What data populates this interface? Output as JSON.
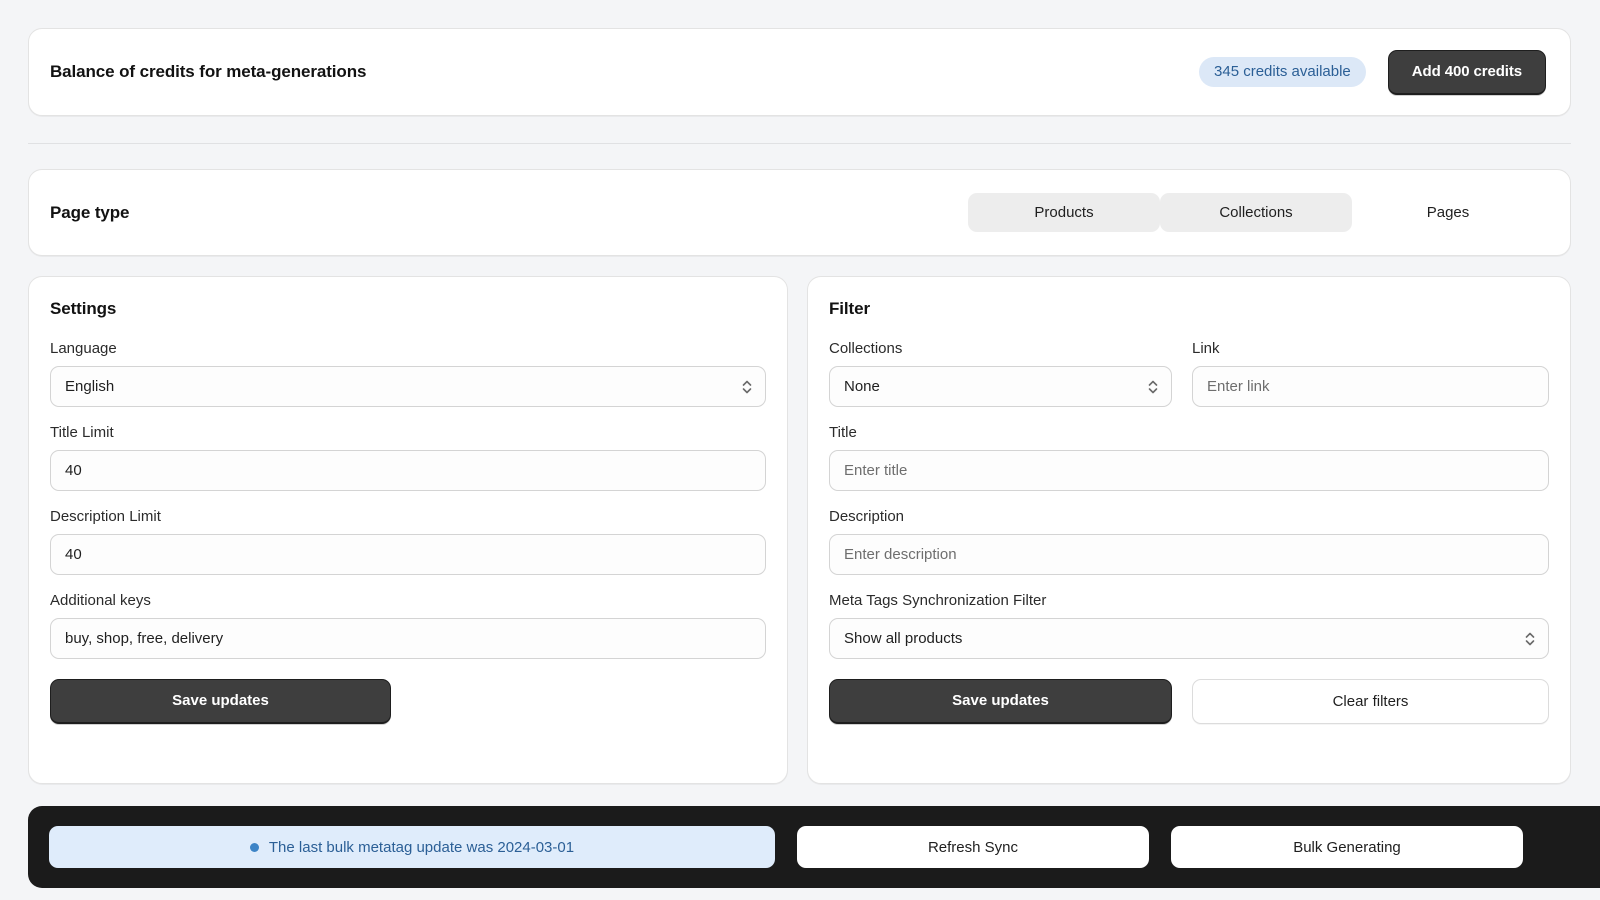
{
  "credits": {
    "title": "Balance of credits for meta-generations",
    "badge": "345 credits available",
    "add_button": "Add 400 credits"
  },
  "page_type": {
    "title": "Page type",
    "tabs": [
      {
        "label": "Products",
        "active": true
      },
      {
        "label": "Collections",
        "active": true
      },
      {
        "label": "Pages",
        "active": false
      }
    ]
  },
  "settings": {
    "title": "Settings",
    "language_label": "Language",
    "language_value": "English",
    "title_limit_label": "Title Limit",
    "title_limit_value": "40",
    "description_limit_label": "Description Limit",
    "description_limit_value": "40",
    "additional_keys_label": "Additional keys",
    "additional_keys_value": "buy, shop, free, delivery",
    "save_button": "Save updates"
  },
  "filter": {
    "title": "Filter",
    "collections_label": "Collections",
    "collections_value": "None",
    "link_label": "Link",
    "link_placeholder": "Enter link",
    "link_value": "",
    "title_label": "Title",
    "title_placeholder": "Enter title",
    "title_value": "",
    "description_label": "Description",
    "description_placeholder": "Enter description",
    "description_value": "",
    "sync_filter_label": "Meta Tags Synchronization Filter",
    "sync_filter_value": "Show all products",
    "save_button": "Save updates",
    "clear_button": "Clear filters"
  },
  "bottom_bar": {
    "status_text": "The last bulk metatag update was 2024-03-01",
    "refresh_button": "Refresh Sync",
    "bulk_button": "Bulk Generating"
  },
  "colors": {
    "page_background": "#f4f5f7",
    "card_background": "#ffffff",
    "accent_dark": "#3e3e3e",
    "badge_background": "#dce8f7",
    "badge_text": "#2b5f96",
    "status_dot": "#3d84c6",
    "bottom_bar": "#1b1b1b"
  }
}
